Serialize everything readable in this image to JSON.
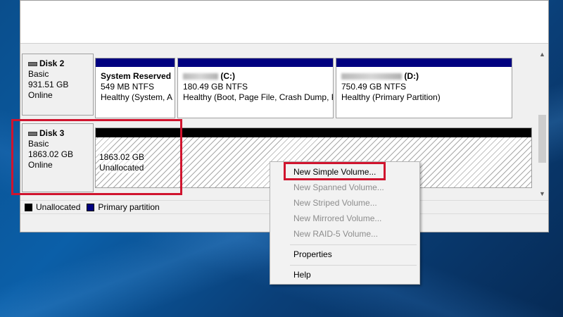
{
  "disks": [
    {
      "name": "Disk 2",
      "type": "Basic",
      "size": "931.51 GB",
      "status": "Online",
      "volumes": [
        {
          "title": "System Reserved",
          "detail": "549 MB NTFS",
          "health": "Healthy (System, A"
        },
        {
          "title_suffix": "(C:)",
          "detail": "180.49 GB NTFS",
          "health": "Healthy (Boot, Page File, Crash Dump, P"
        },
        {
          "title_suffix": "(D:)",
          "detail": "750.49 GB NTFS",
          "health": "Healthy (Primary Partition)"
        }
      ]
    },
    {
      "name": "Disk 3",
      "type": "Basic",
      "size": "1863.02 GB",
      "status": "Online",
      "unallocated": {
        "size": "1863.02 GB",
        "label": "Unallocated"
      }
    }
  ],
  "legend": [
    {
      "label": "Unallocated",
      "color": "#000000"
    },
    {
      "label": "Primary partition",
      "color": "#000080"
    }
  ],
  "context_menu": {
    "items": [
      {
        "label": "New Simple Volume...",
        "enabled": true
      },
      {
        "label": "New Spanned Volume...",
        "enabled": false
      },
      {
        "label": "New Striped Volume...",
        "enabled": false
      },
      {
        "label": "New Mirrored Volume...",
        "enabled": false
      },
      {
        "label": "New RAID-5 Volume...",
        "enabled": false
      },
      {
        "label": "Properties",
        "enabled": true
      },
      {
        "label": "Help",
        "enabled": true
      }
    ]
  },
  "colors": {
    "primary_partition_bar": "#000080",
    "unallocated_bar": "#000000",
    "highlight": "#d0142e"
  },
  "icons": {
    "disk": "disk-drive-icon",
    "scroll_up": "chevron-up-icon",
    "scroll_down": "chevron-down-icon"
  }
}
